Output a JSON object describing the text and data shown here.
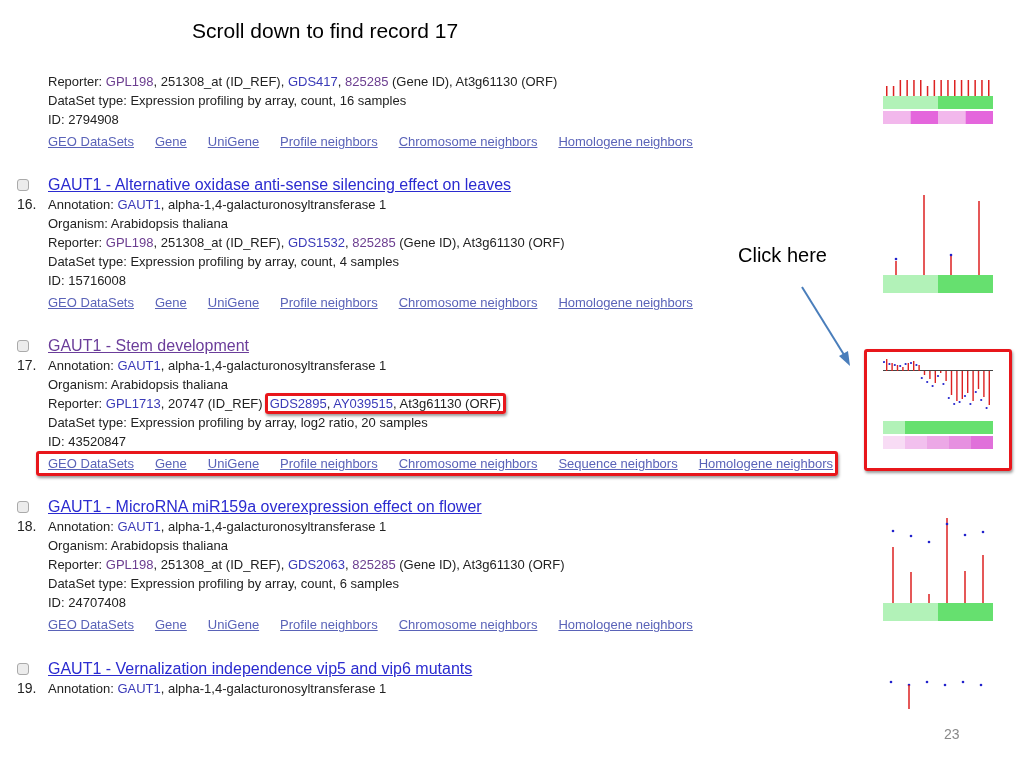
{
  "slide": {
    "title": "Scroll down to find record 17",
    "callout": "Click here",
    "page_number": "23"
  },
  "records": [
    {
      "highlighted": false,
      "lines": [
        {
          "parts": [
            {
              "kind": "text",
              "text": "Reporter: "
            },
            {
              "kind": "visited",
              "text": "GPL198"
            },
            {
              "kind": "text",
              "text": ", 251308_at (ID_REF), "
            },
            {
              "kind": "link",
              "text": "GDS417"
            },
            {
              "kind": "text",
              "text": ", "
            },
            {
              "kind": "visited",
              "text": "825285"
            },
            {
              "kind": "text",
              "text": " (Gene ID), At3g61130 (ORF)"
            }
          ]
        },
        {
          "parts": [
            {
              "kind": "text",
              "text": "DataSet type: Expression profiling by array, count, 16 samples"
            }
          ]
        },
        {
          "parts": [
            {
              "kind": "text",
              "text": "ID: 2794908"
            }
          ]
        }
      ],
      "links": [
        "GEO DataSets",
        "Gene",
        "UniGene",
        "Profile neighbors",
        "Chromosome neighbors",
        "Homologene neighbors"
      ]
    },
    {
      "checked": false,
      "number": "16.",
      "title": "GAUT1 - Alternative oxidase anti-sense silencing effect on leaves",
      "visited": false,
      "highlighted": false,
      "lines": [
        {
          "parts": [
            {
              "kind": "text",
              "text": "Annotation: "
            },
            {
              "kind": "link",
              "text": "GAUT1"
            },
            {
              "kind": "text",
              "text": ", alpha-1,4-galacturonosyltransferase 1"
            }
          ]
        },
        {
          "parts": [
            {
              "kind": "text",
              "text": "Organism: Arabidopsis thaliana"
            }
          ]
        },
        {
          "parts": [
            {
              "kind": "text",
              "text": "Reporter: "
            },
            {
              "kind": "visited",
              "text": "GPL198"
            },
            {
              "kind": "text",
              "text": ", 251308_at (ID_REF), "
            },
            {
              "kind": "link",
              "text": "GDS1532"
            },
            {
              "kind": "text",
              "text": ", "
            },
            {
              "kind": "visited",
              "text": "825285"
            },
            {
              "kind": "text",
              "text": " (Gene ID), At3g61130 (ORF)"
            }
          ]
        },
        {
          "parts": [
            {
              "kind": "text",
              "text": "DataSet type: Expression profiling by array, count, 4 samples"
            }
          ]
        },
        {
          "parts": [
            {
              "kind": "text",
              "text": "ID: 15716008"
            }
          ]
        }
      ],
      "links": [
        "GEO DataSets",
        "Gene",
        "UniGene",
        "Profile neighbors",
        "Chromosome neighbors",
        "Homologene neighbors"
      ]
    },
    {
      "checked": false,
      "number": "17.",
      "title": "GAUT1 - Stem development",
      "visited": true,
      "highlighted": true,
      "lines": [
        {
          "parts": [
            {
              "kind": "text",
              "text": "Annotation: "
            },
            {
              "kind": "link",
              "text": "GAUT1"
            },
            {
              "kind": "text",
              "text": ", alpha-1,4-galacturonosyltransferase 1"
            }
          ]
        },
        {
          "parts": [
            {
              "kind": "text",
              "text": "Organism: Arabidopsis thaliana"
            }
          ]
        },
        {
          "parts": [
            {
              "kind": "text",
              "text": "Reporter: "
            },
            {
              "kind": "link",
              "text": "GPL1713"
            },
            {
              "kind": "text",
              "text": ", 20747 (ID_REF)"
            }
          ],
          "boxed_parts": [
            {
              "kind": "link",
              "text": "GDS2895"
            },
            {
              "kind": "text",
              "text": ", "
            },
            {
              "kind": "link",
              "text": "AY039515"
            },
            {
              "kind": "text",
              "text": ", At3g61130 (ORF)"
            }
          ]
        },
        {
          "parts": [
            {
              "kind": "text",
              "text": "DataSet type: Expression profiling by array, log2 ratio, 20 samples"
            }
          ]
        },
        {
          "parts": [
            {
              "kind": "text",
              "text": "ID: 43520847"
            }
          ]
        }
      ],
      "links": [
        "GEO DataSets",
        "Gene",
        "UniGene",
        "Profile neighbors",
        "Chromosome neighbors",
        "Sequence neighbors",
        "Homologene neighbors"
      ]
    },
    {
      "checked": false,
      "number": "18.",
      "title": "GAUT1 - MicroRNA miR159a overexpression effect on flower",
      "visited": false,
      "highlighted": false,
      "lines": [
        {
          "parts": [
            {
              "kind": "text",
              "text": "Annotation: "
            },
            {
              "kind": "link",
              "text": "GAUT1"
            },
            {
              "kind": "text",
              "text": ", alpha-1,4-galacturonosyltransferase 1"
            }
          ]
        },
        {
          "parts": [
            {
              "kind": "text",
              "text": "Organism: Arabidopsis thaliana"
            }
          ]
        },
        {
          "parts": [
            {
              "kind": "text",
              "text": "Reporter: "
            },
            {
              "kind": "visited",
              "text": "GPL198"
            },
            {
              "kind": "text",
              "text": ", 251308_at (ID_REF), "
            },
            {
              "kind": "link",
              "text": "GDS2063"
            },
            {
              "kind": "text",
              "text": ", "
            },
            {
              "kind": "visited",
              "text": "825285"
            },
            {
              "kind": "text",
              "text": " (Gene ID), At3g61130 (ORF)"
            }
          ]
        },
        {
          "parts": [
            {
              "kind": "text",
              "text": "DataSet type: Expression profiling by array, count, 6 samples"
            }
          ]
        },
        {
          "parts": [
            {
              "kind": "text",
              "text": "ID: 24707408"
            }
          ]
        }
      ],
      "links": [
        "GEO DataSets",
        "Gene",
        "UniGene",
        "Profile neighbors",
        "Chromosome neighbors",
        "Homologene neighbors"
      ]
    },
    {
      "checked": false,
      "number": "19.",
      "title": "GAUT1 - Vernalization independence vip5 and vip6 mutants",
      "visited": false,
      "highlighted": false,
      "lines": [
        {
          "parts": [
            {
              "kind": "text",
              "text": "Annotation: "
            },
            {
              "kind": "link",
              "text": "GAUT1"
            },
            {
              "kind": "text",
              "text": ", alpha-1,4-galacturonosyltransferase 1"
            }
          ]
        }
      ]
    }
  ]
}
